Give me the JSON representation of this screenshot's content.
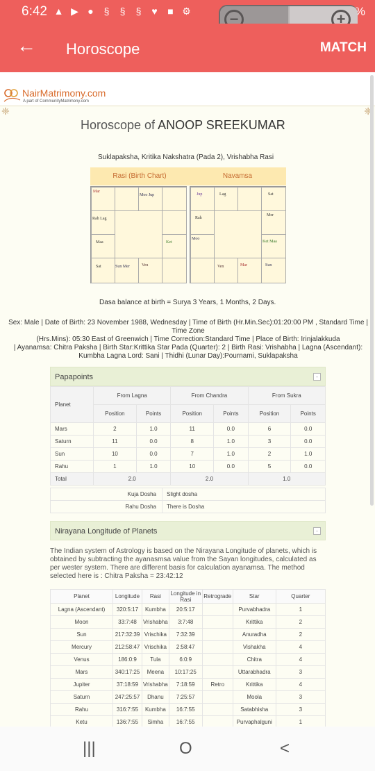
{
  "status_bar": {
    "time": "6:42",
    "right_text": "33%"
  },
  "app_bar": {
    "title": "Horoscope",
    "action": "MATCH"
  },
  "logo": {
    "brand": "NairMatrimony.com",
    "tagline": "A part of CommunityMatrimony.com"
  },
  "page": {
    "heading_prefix": "Horoscope of",
    "name": "ANOOP SREEKUMAR",
    "subtitle": "Suklapaksha, Kritika Nakshatra (Pada 2), Vrishabha Rasi",
    "rasi_title": "Rasi (Birth Chart)",
    "navamsa_title": "Navamsa",
    "dasa": "Dasa balance at birth = Surya 3 Years, 1 Months, 2 Days.",
    "birth_line1": "Sex: Male | Date of Birth: 23 November 1988, Wednesday | Time of Birth (Hr.Min.Sec):01:20:00 PM , Standard Time | Time Zone",
    "birth_line2": "(Hrs.Mins): 05:30 East of Greenwich | Time Correction:Standard Time | Place of Birth: Irinjalakkuda",
    "birth_line3": "| Ayanamsa: Chitra Paksha | Birth Star:Krittika Star Pada (Quarter): 2 | Birth Rasi: Vrishabha | Lagna (Ascendant):",
    "birth_line4": "Kumbha Lagna Lord: Sani | Thidhi (Lunar Day):Pournami, Suklapaksha"
  },
  "rasi_chart": {
    "c00": "Mar",
    "c01": "",
    "c02": "Moo  Jup",
    "c03": "",
    "c10": "Rah  Lag",
    "c13": "",
    "c20": "Maa",
    "c23": "Ket",
    "c30": "Sat",
    "c31": "Sun  Mer",
    "c32": "Ven",
    "c33": ""
  },
  "navamsa_chart": {
    "c00": "Jup",
    "c01": "Lag",
    "c02": "",
    "c03": "Sat",
    "c10": "Rah",
    "c13": "Mer",
    "c20": "Moo",
    "c23": "Ket   Maa",
    "c30": "",
    "c31": "Ven",
    "c32": "Mar",
    "c33": "Sun"
  },
  "papapoints": {
    "title": "Papapoints",
    "headers": {
      "planet": "Planet",
      "from_lagna": "From Lagna",
      "from_chandra": "From Chandra",
      "from_sukra": "From Sukra",
      "position": "Position",
      "points": "Points"
    },
    "rows": [
      [
        "Mars",
        "2",
        "1.0",
        "11",
        "0.0",
        "6",
        "0.0"
      ],
      [
        "Saturn",
        "11",
        "0.0",
        "8",
        "1.0",
        "3",
        "0.0"
      ],
      [
        "Sun",
        "10",
        "0.0",
        "7",
        "1.0",
        "2",
        "1.0"
      ],
      [
        "Rahu",
        "1",
        "1.0",
        "10",
        "0.0",
        "5",
        "0.0"
      ]
    ],
    "total": [
      "Total",
      "2.0",
      "2.0",
      "1.0"
    ],
    "dosha": [
      [
        "Kuja Dosha",
        "Slight dosha"
      ],
      [
        "Rahu Dosha",
        "There is Dosha"
      ]
    ]
  },
  "nirayana": {
    "title": "Nirayana Longitude of Planets",
    "description": "The Indian system of Astrology is based on the Nirayana Longitude of planets, which is obtained by subtracting the ayanasmsa value from the Sayan longitudes, calculated as per wester system. There are different basis for calculation ayanamsa. The method selected here is : Chitra Paksha = 23:42:12",
    "headers": [
      "Planet",
      "Longitude",
      "Rasi",
      "Longitude in Rasi",
      "Retrograde",
      "Star",
      "Quarter"
    ],
    "rows": [
      [
        "Lagna (Ascendant)",
        "320:5:17",
        "Kumbha",
        "20:5:17",
        "",
        "Purvabhadra",
        "1"
      ],
      [
        "Moon",
        "33:7:48",
        "Vrishabha",
        "3:7:48",
        "",
        "Krittika",
        "2"
      ],
      [
        "Sun",
        "217:32:39",
        "Vrischika",
        "7:32:39",
        "",
        "Anuradha",
        "2"
      ],
      [
        "Mercury",
        "212:58:47",
        "Vrischika",
        "2:58:47",
        "",
        "Vishakha",
        "4"
      ],
      [
        "Venus",
        "186:0:9",
        "Tula",
        "6:0:9",
        "",
        "Chitra",
        "4"
      ],
      [
        "Mars",
        "340:17:25",
        "Meena",
        "10:17:25",
        "",
        "Uttarabhadra",
        "3"
      ],
      [
        "Jupiter",
        "37:18:59",
        "Vrishabha",
        "7:18:59",
        "Retro",
        "Krittika",
        "4"
      ],
      [
        "Saturn",
        "247:25:57",
        "Dhanu",
        "7:25:57",
        "",
        "Moola",
        "3"
      ],
      [
        "Rahu",
        "316:7:55",
        "Kumbha",
        "16:7:55",
        "",
        "Satabhisha",
        "3"
      ],
      [
        "Ketu",
        "136:7:55",
        "Simha",
        "16:7:55",
        "",
        "Purvaphalguni",
        "1"
      ]
    ]
  },
  "toggle_symbol": "-",
  "nav": {
    "recents": "|||",
    "home": "O",
    "back": "<"
  }
}
